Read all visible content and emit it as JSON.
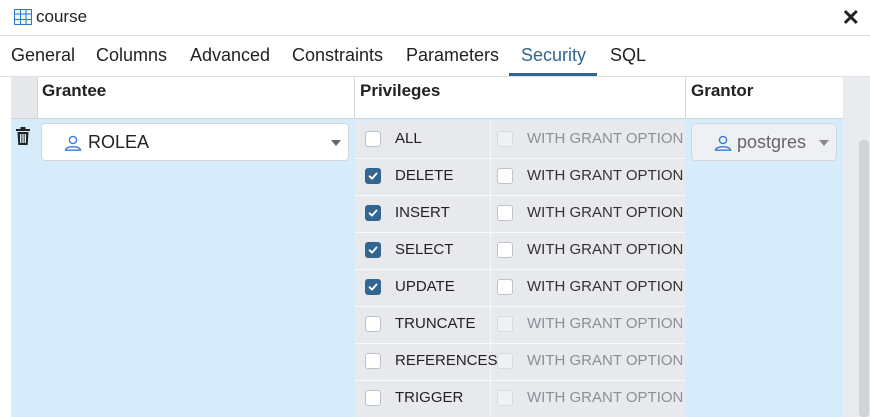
{
  "window": {
    "title": "course"
  },
  "tabs": [
    {
      "label": "General"
    },
    {
      "label": "Columns"
    },
    {
      "label": "Advanced"
    },
    {
      "label": "Constraints"
    },
    {
      "label": "Parameters"
    },
    {
      "label": "Security",
      "active": true
    },
    {
      "label": "SQL"
    }
  ],
  "grid": {
    "headers": {
      "grantee": "Grantee",
      "privileges": "Privileges",
      "grantor": "Grantor"
    },
    "row": {
      "grantee": "ROLEA",
      "grantor": "postgres",
      "privileges": [
        {
          "name": "ALL",
          "checked": false,
          "with_grant_option": "WITH GRANT OPTION",
          "wgo_enabled": false,
          "wgo_checked": false
        },
        {
          "name": "DELETE",
          "checked": true,
          "with_grant_option": "WITH GRANT OPTION",
          "wgo_enabled": true,
          "wgo_checked": false
        },
        {
          "name": "INSERT",
          "checked": true,
          "with_grant_option": "WITH GRANT OPTION",
          "wgo_enabled": true,
          "wgo_checked": false
        },
        {
          "name": "SELECT",
          "checked": true,
          "with_grant_option": "WITH GRANT OPTION",
          "wgo_enabled": true,
          "wgo_checked": false
        },
        {
          "name": "UPDATE",
          "checked": true,
          "with_grant_option": "WITH GRANT OPTION",
          "wgo_enabled": true,
          "wgo_checked": false
        },
        {
          "name": "TRUNCATE",
          "checked": false,
          "with_grant_option": "WITH GRANT OPTION",
          "wgo_enabled": false,
          "wgo_checked": false
        },
        {
          "name": "REFERENCES",
          "checked": false,
          "with_grant_option": "WITH GRANT OPTION",
          "wgo_enabled": false,
          "wgo_checked": false
        },
        {
          "name": "TRIGGER",
          "checked": false,
          "with_grant_option": "WITH GRANT OPTION",
          "wgo_enabled": false,
          "wgo_checked": false
        }
      ]
    }
  },
  "colors": {
    "accent": "#326690",
    "row_highlight": "#d7ecfb"
  },
  "icons": {
    "title": "table-icon",
    "close": "close-icon",
    "delete": "trash-icon",
    "role": "user-icon",
    "dropdown": "chevron-down-icon"
  }
}
